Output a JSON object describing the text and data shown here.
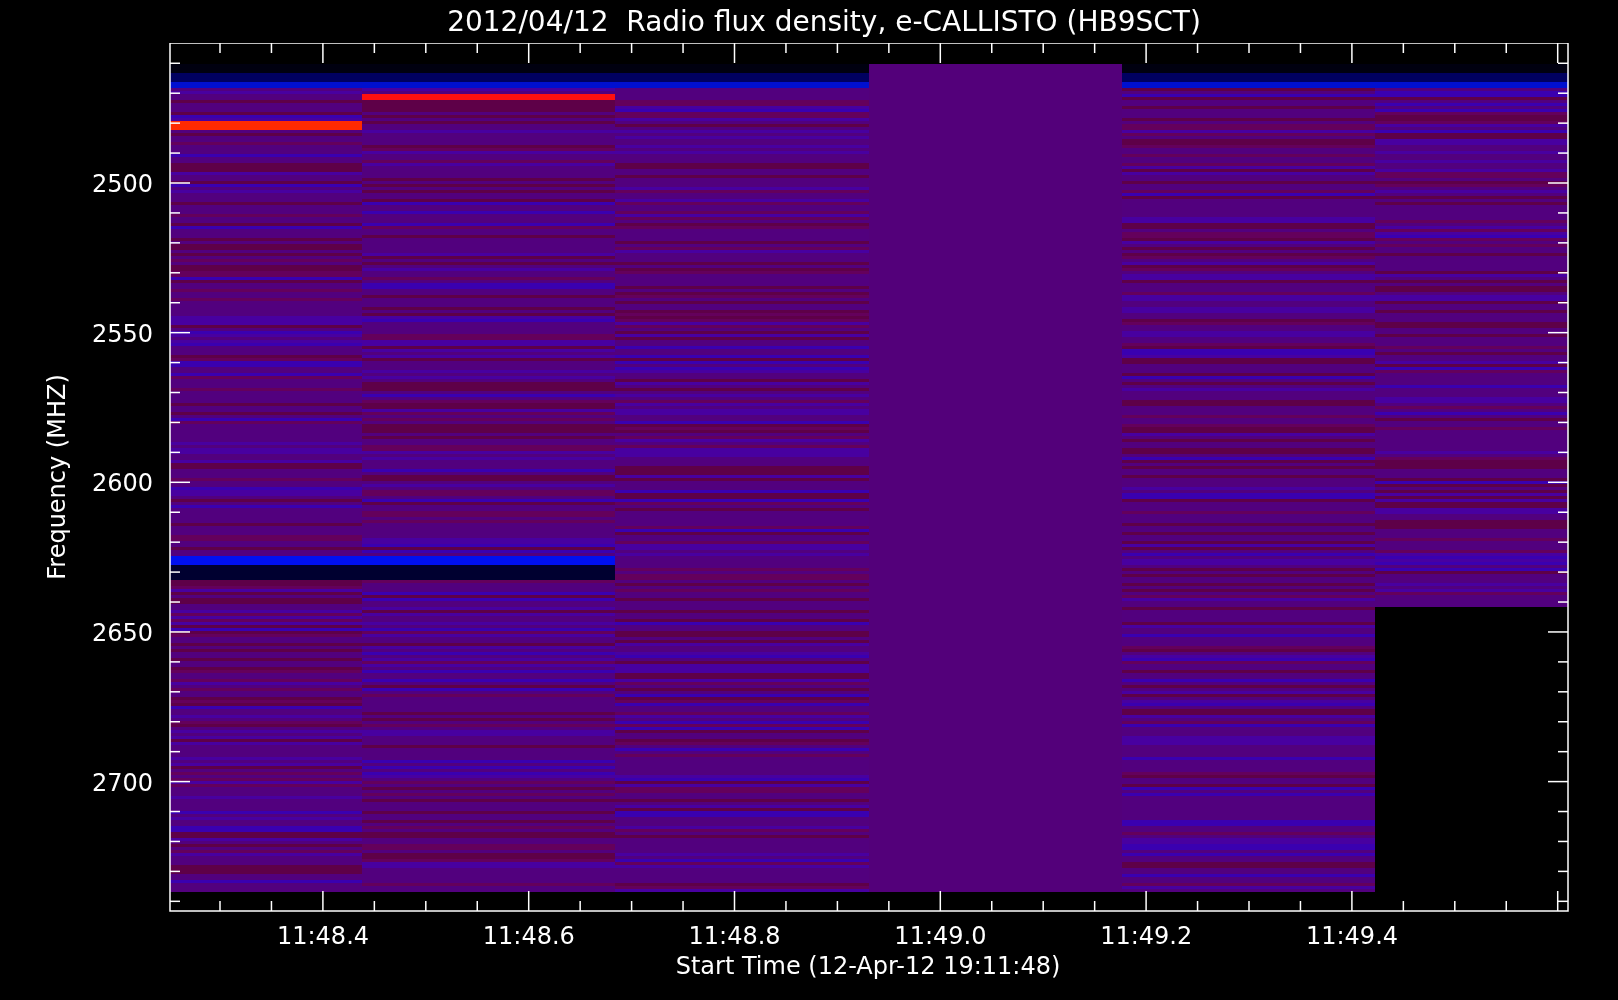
{
  "title": "2012/04/12  Radio flux density, e-CALLISTO (HB9SCT)",
  "y_axis": {
    "title": "Frequency (MHZ)",
    "tick_labels": [
      "2500",
      "2550",
      "2600",
      "2650",
      "2700"
    ]
  },
  "x_axis": {
    "title": "Start Time (12-Apr-12 19:11:48)",
    "tick_labels": [
      "11:48.4",
      "11:48.6",
      "11:48.8",
      "11:49.0",
      "11:49.2",
      "11:49.4"
    ]
  }
}
